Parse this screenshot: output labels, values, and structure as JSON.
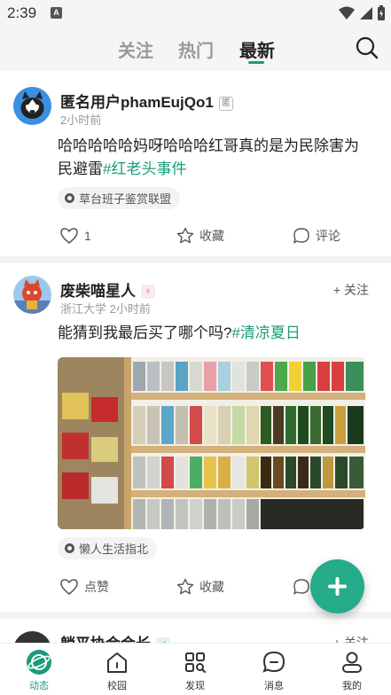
{
  "status_bar": {
    "time": "2:39",
    "notif_icon_letter": "A"
  },
  "top_nav": {
    "tabs": [
      {
        "label": "关注",
        "active": false
      },
      {
        "label": "热门",
        "active": false
      },
      {
        "label": "最新",
        "active": true
      }
    ]
  },
  "posts": [
    {
      "author": "匿名用户phamEujQo1",
      "badge": "匿",
      "meta": "2小时前",
      "text": "哈哈哈哈哈妈呀哈哈哈红哥真的是为民除害为民避雷",
      "hashtag": "#红老头事件",
      "circle": "草台班子鉴赏联盟",
      "likes": "1",
      "collect_label": "收藏",
      "comment_label": "评论"
    },
    {
      "author": "废柴喵星人",
      "gender": "female",
      "school": "浙江大学",
      "time": "2小时前",
      "follow_label": "+ 关注",
      "text": "能猜到我最后买了哪个吗?",
      "hashtag": "#清凉夏日",
      "circle": "懒人生活指北",
      "like_label": "点赞",
      "collect_label": "收藏"
    },
    {
      "author": "躺平协会会长",
      "follow_label": "+ 关注"
    }
  ],
  "bottom_nav": {
    "items": [
      {
        "label": "动态",
        "icon": "planet-icon",
        "active": true
      },
      {
        "label": "校园",
        "icon": "home-icon",
        "active": false
      },
      {
        "label": "发现",
        "icon": "discover-grid-icon",
        "active": false
      },
      {
        "label": "消息",
        "icon": "chat-bubble-icon",
        "active": false
      },
      {
        "label": "我的",
        "icon": "profile-icon",
        "active": false
      }
    ]
  },
  "colors": {
    "accent": "#1a9c7a",
    "fab": "#25ab87",
    "meta": "#999999"
  }
}
